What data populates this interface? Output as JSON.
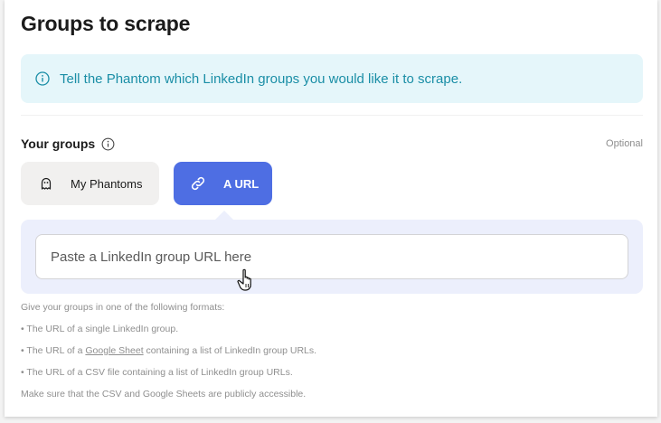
{
  "title": "Groups to scrape",
  "info": {
    "icon": "info-circle-icon",
    "text": "Tell the Phantom which LinkedIn groups you would like it to scrape.",
    "color": "#1a8ea6",
    "background": "#e5f6fa"
  },
  "section": {
    "label": "Your groups",
    "help_icon": "info-circle-icon",
    "optional": "Optional"
  },
  "tabs": [
    {
      "label": "My Phantoms",
      "icon": "phantom-ghost-icon",
      "selected": false
    },
    {
      "label": "A URL",
      "icon": "link-icon",
      "selected": true,
      "color": "#4e6ee3"
    }
  ],
  "url_input": {
    "placeholder": "Paste a LinkedIn group URL here",
    "value": ""
  },
  "help": {
    "intro": "Give your groups in one of the following formats:",
    "item1": "• The URL of a single LinkedIn group.",
    "item2_prefix": "• The URL of a ",
    "item2_link": "Google Sheet",
    "item2_suffix": " containing a list of LinkedIn group URLs.",
    "item3": "• The URL of a CSV file containing a list of LinkedIn group URLs.",
    "note": "Make sure that the CSV and Google Sheets are publicly accessible."
  }
}
